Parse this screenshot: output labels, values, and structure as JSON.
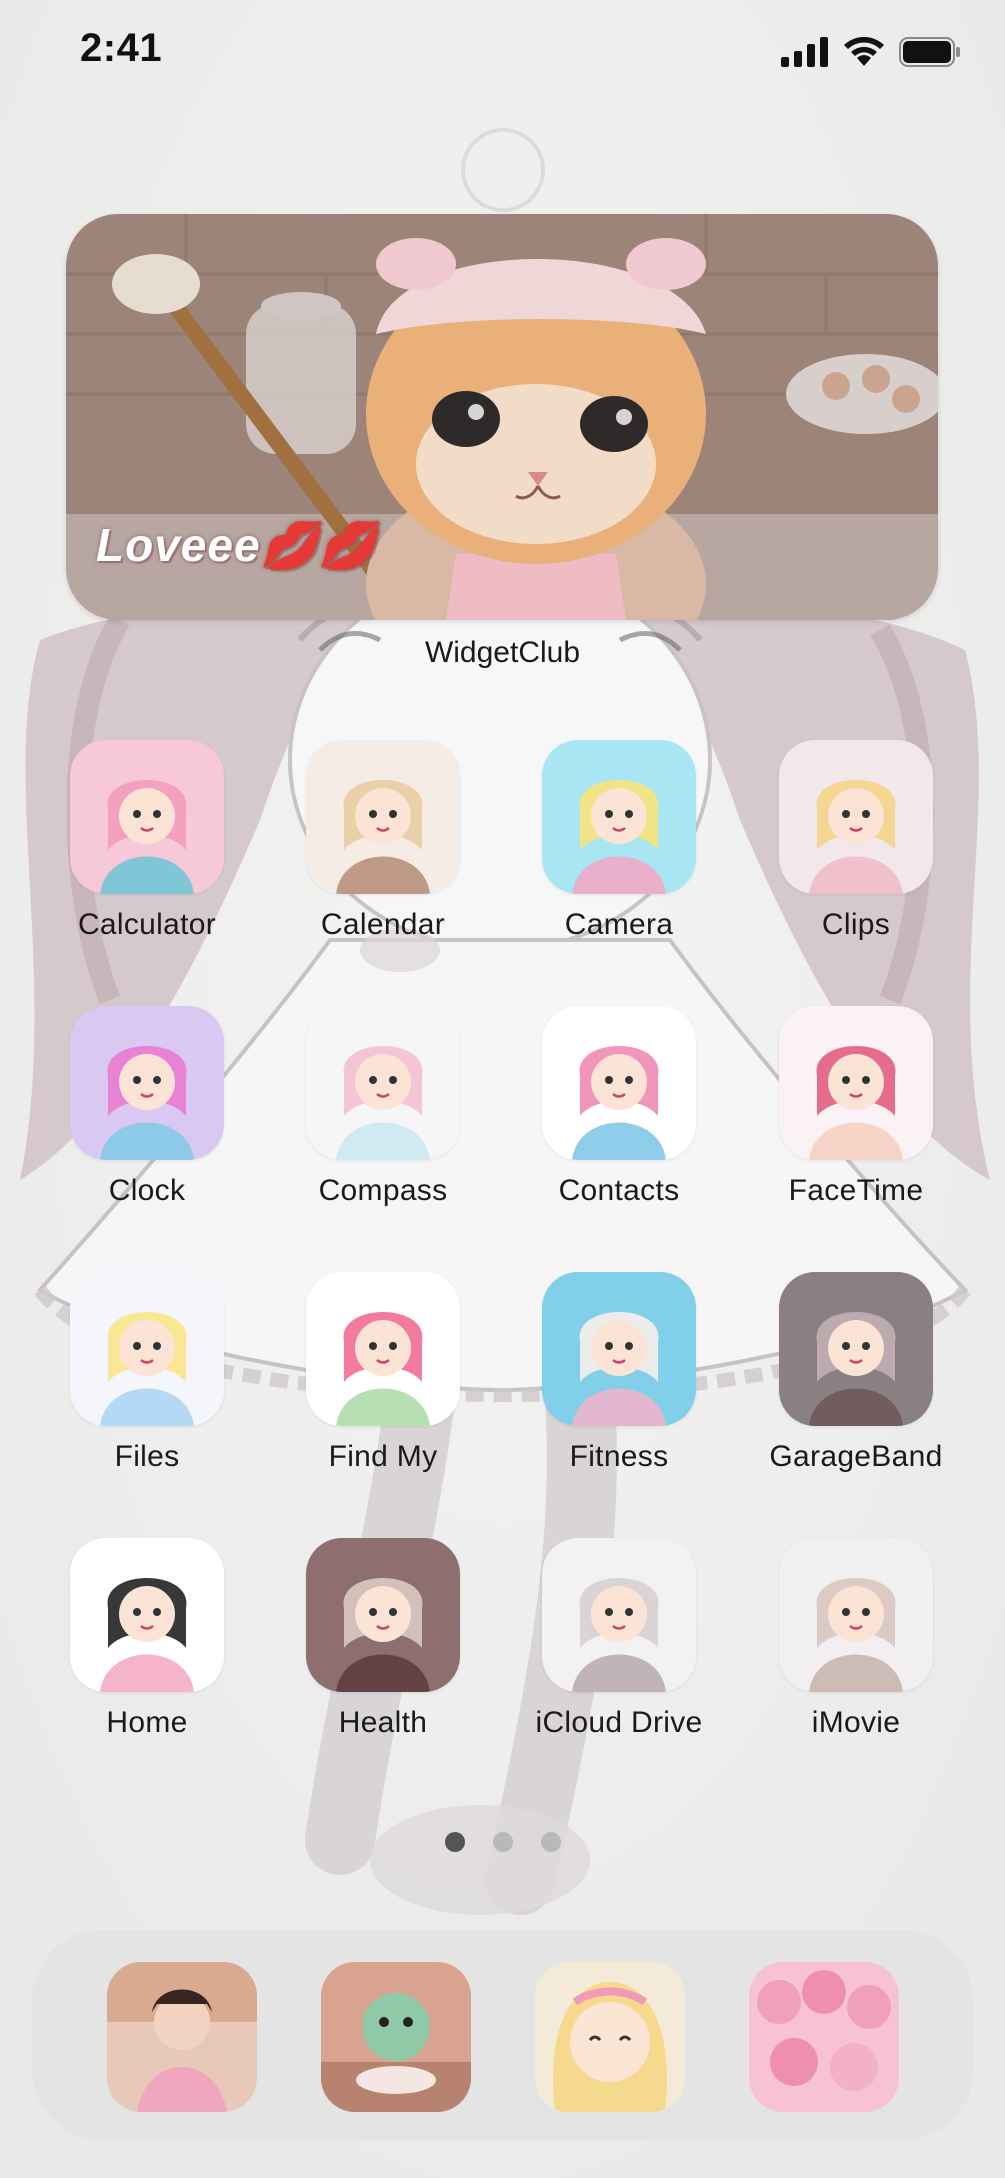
{
  "status_bar": {
    "time": "2:41",
    "signal_icon": "cellular-signal-icon",
    "wifi_icon": "wifi-icon",
    "battery_icon": "battery-icon"
  },
  "widget": {
    "text": "Loveee💋💋",
    "label": "WidgetClub",
    "image": "kitten-painting-image"
  },
  "apps": [
    {
      "label": "Calculator",
      "icon": "calculator-icon"
    },
    {
      "label": "Calendar",
      "icon": "calendar-icon"
    },
    {
      "label": "Camera",
      "icon": "camera-icon"
    },
    {
      "label": "Clips",
      "icon": "clips-icon"
    },
    {
      "label": "Clock",
      "icon": "clock-icon"
    },
    {
      "label": "Compass",
      "icon": "compass-icon"
    },
    {
      "label": "Contacts",
      "icon": "contacts-icon"
    },
    {
      "label": "FaceTime",
      "icon": "facetime-icon"
    },
    {
      "label": "Files",
      "icon": "files-icon"
    },
    {
      "label": "Find My",
      "icon": "find-my-icon"
    },
    {
      "label": "Fitness",
      "icon": "fitness-icon"
    },
    {
      "label": "GarageBand",
      "icon": "garageband-icon"
    },
    {
      "label": "Home",
      "icon": "home-icon"
    },
    {
      "label": "Health",
      "icon": "health-icon"
    },
    {
      "label": "iCloud Drive",
      "icon": "icloud-drive-icon"
    },
    {
      "label": "iMovie",
      "icon": "imovie-icon"
    }
  ],
  "page_indicator": {
    "pages": 3,
    "current": 1
  },
  "dock": [
    {
      "icon": "dock-app-1-icon"
    },
    {
      "icon": "dock-app-2-icon"
    },
    {
      "icon": "dock-app-3-icon"
    },
    {
      "icon": "dock-app-4-icon"
    }
  ],
  "colors": {
    "background": "#efefee",
    "label_text": "#1a1a1a",
    "accent_pink": "#f4a7c0"
  }
}
